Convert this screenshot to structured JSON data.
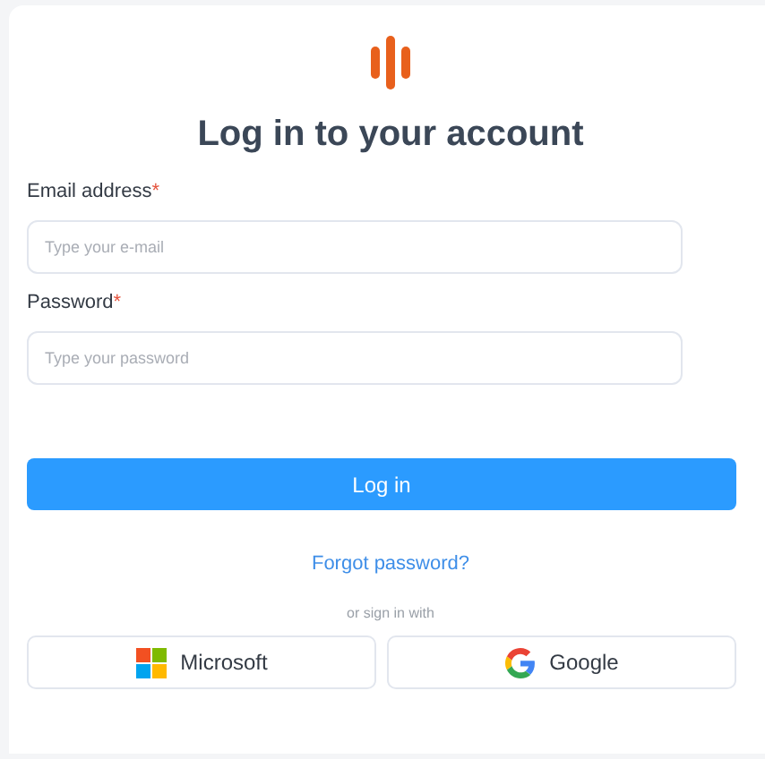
{
  "title": "Log in to your account",
  "fields": [
    {
      "label": "Email address",
      "required_mark": "*",
      "placeholder": "Type your e-mail"
    },
    {
      "label": "Password",
      "required_mark": "*",
      "placeholder": "Type your password"
    }
  ],
  "submit": "Log in",
  "forgot_link": "Forgot password?",
  "divider_text": "or sign in with",
  "providers": [
    {
      "kind": "microsoft",
      "label": "Microsoft"
    },
    {
      "kind": "google",
      "label": "Google"
    }
  ]
}
